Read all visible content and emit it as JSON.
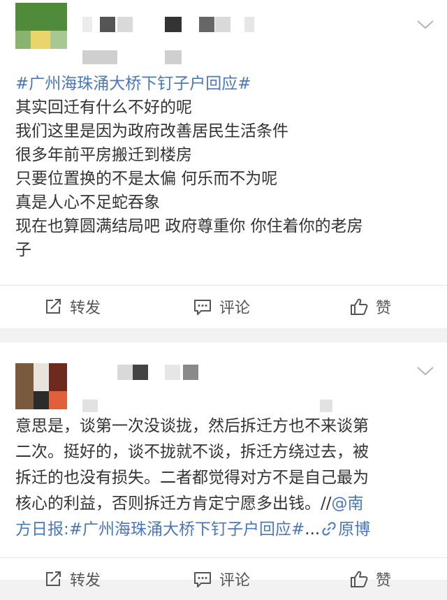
{
  "post1": {
    "topic": "#广州海珠涌大桥下钉子户回应#",
    "lines": [
      "其实回迁有什么不好的呢",
      "我们这里是因为政府改善居民生活条件",
      "很多年前平房搬迁到楼房",
      "只要位置换的不是太偏 何乐而不为呢",
      "真是人心不足蛇吞象",
      "现在也算圆满结局吧 政府尊重你 你住着你的老房",
      "子"
    ],
    "actions": {
      "repost": "转发",
      "comment": "评论",
      "like": "赞"
    }
  },
  "post2": {
    "lines": [
      "意思是，谈第一次没谈拢，然后拆迁方也不来谈第",
      "二次。挺好的，谈不拢就不谈，拆迁方绕过去，被",
      "拆迁的也没有损失。二者都觉得对方不是自己最为",
      "核心的利益，否则拆迁方肯定宁愿多出钱。//"
    ],
    "mention_part1": "@南",
    "line5_prefix": "方日报:",
    "topic": "#广州海珠涌大桥下钉子户回应#",
    "ellipsis": "...",
    "original_link": "原博",
    "actions": {
      "repost": "转发",
      "comment": "评论",
      "like": "赞"
    }
  },
  "icons": [
    "chevron-down-icon",
    "repost-icon",
    "comment-icon",
    "like-icon",
    "link-icon"
  ]
}
